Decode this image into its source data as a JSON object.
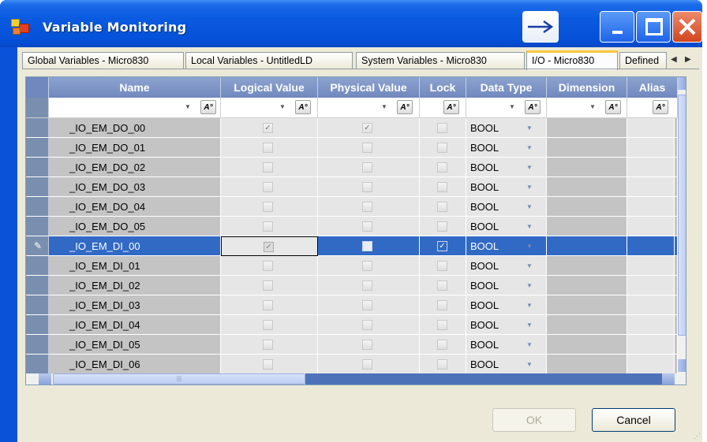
{
  "window": {
    "title": "Variable Monitoring",
    "accent_color": "#0a53d9"
  },
  "tabs": [
    {
      "label": "Global Variables - Micro830",
      "active": false
    },
    {
      "label": "Local Variables - UntitledLD",
      "active": false
    },
    {
      "label": "System Variables - Micro830",
      "active": false
    },
    {
      "label": "I/O - Micro830",
      "active": true
    },
    {
      "label": "Defined",
      "active": false
    }
  ],
  "grid": {
    "columns": [
      "Name",
      "Logical Value",
      "Physical Value",
      "Lock",
      "Data Type",
      "Dimension",
      "Alias"
    ],
    "selected_color": "#316ac5",
    "rows": [
      {
        "name": "_IO_EM_DO_00",
        "logical": true,
        "physical": true,
        "lock": false,
        "type": "BOOL"
      },
      {
        "name": "_IO_EM_DO_01",
        "logical": false,
        "physical": false,
        "lock": false,
        "type": "BOOL"
      },
      {
        "name": "_IO_EM_DO_02",
        "logical": false,
        "physical": false,
        "lock": false,
        "type": "BOOL"
      },
      {
        "name": "_IO_EM_DO_03",
        "logical": false,
        "physical": false,
        "lock": false,
        "type": "BOOL"
      },
      {
        "name": "_IO_EM_DO_04",
        "logical": false,
        "physical": false,
        "lock": false,
        "type": "BOOL"
      },
      {
        "name": "_IO_EM_DO_05",
        "logical": false,
        "physical": false,
        "lock": false,
        "type": "BOOL"
      },
      {
        "name": "_IO_EM_DI_00",
        "logical": true,
        "physical": false,
        "lock": true,
        "type": "BOOL",
        "selected": true
      },
      {
        "name": "_IO_EM_DI_01",
        "logical": false,
        "physical": false,
        "lock": false,
        "type": "BOOL"
      },
      {
        "name": "_IO_EM_DI_02",
        "logical": false,
        "physical": false,
        "lock": false,
        "type": "BOOL"
      },
      {
        "name": "_IO_EM_DI_03",
        "logical": false,
        "physical": false,
        "lock": false,
        "type": "BOOL"
      },
      {
        "name": "_IO_EM_DI_04",
        "logical": false,
        "physical": false,
        "lock": false,
        "type": "BOOL"
      },
      {
        "name": "_IO_EM_DI_05",
        "logical": false,
        "physical": false,
        "lock": false,
        "type": "BOOL"
      },
      {
        "name": "_IO_EM_DI_06",
        "logical": false,
        "physical": false,
        "lock": false,
        "type": "BOOL"
      }
    ]
  },
  "buttons": {
    "ok": "OK",
    "cancel": "Cancel"
  }
}
